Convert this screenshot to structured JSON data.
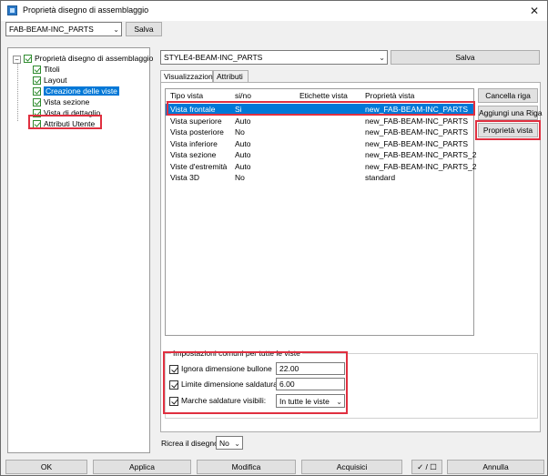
{
  "window": {
    "title": "Proprietà disegno di assemblaggio",
    "close_glyph": "✕"
  },
  "topbar": {
    "preset_value": "FAB-BEAM-INC_PARTS",
    "save_label": "Salva"
  },
  "tree": {
    "root_label": "Proprietà disegno di assemblaggio",
    "items": [
      {
        "label": "Titoli"
      },
      {
        "label": "Layout"
      },
      {
        "label": "Creazione delle viste",
        "selected": true
      },
      {
        "label": "Vista sezione"
      },
      {
        "label": "Vista di dettaglio"
      },
      {
        "label": "Attributi Utente",
        "highlighted": true
      }
    ]
  },
  "right": {
    "style_value": "STYLE4-BEAM-INC_PARTS",
    "save_label": "Salva",
    "tabs": [
      {
        "label": "Visualizzazioni",
        "active": true
      },
      {
        "label": "Attributi",
        "active": false
      }
    ]
  },
  "grid": {
    "columns": [
      "Tipo vista",
      "si/no",
      "Etichette vista",
      "Proprietà vista"
    ],
    "rows": [
      {
        "tipo": "Vista frontale",
        "sino": "Si",
        "etichette": "",
        "proprieta": "new_FAB-BEAM-INC_PARTS",
        "selected": true
      },
      {
        "tipo": "Vista superiore",
        "sino": "Auto",
        "etichette": "",
        "proprieta": "new_FAB-BEAM-INC_PARTS"
      },
      {
        "tipo": "Vista posteriore",
        "sino": "No",
        "etichette": "",
        "proprieta": "new_FAB-BEAM-INC_PARTS"
      },
      {
        "tipo": "Vista inferiore",
        "sino": "Auto",
        "etichette": "",
        "proprieta": "new_FAB-BEAM-INC_PARTS"
      },
      {
        "tipo": "Vista sezione",
        "sino": "Auto",
        "etichette": "",
        "proprieta": "new_FAB-BEAM-INC_PARTS_2"
      },
      {
        "tipo": "Viste d'estremità",
        "sino": "Auto",
        "etichette": "",
        "proprieta": "new_FAB-BEAM-INC_PARTS_2"
      },
      {
        "tipo": "Vista 3D",
        "sino": "No",
        "etichette": "",
        "proprieta": "standard"
      }
    ]
  },
  "side_buttons": {
    "delete_row": "Cancella riga",
    "add_row": "Aggiungi una Riga",
    "view_props": "Proprietà vista"
  },
  "common": {
    "legend": "Impostazioni comuni per tutte le viste",
    "options": [
      {
        "label": "Ignora dimensione bullone",
        "value": "22.00",
        "checked": true
      },
      {
        "label": "Limite dimensione saldatura",
        "value": "6.00",
        "checked": true
      }
    ],
    "welds": {
      "label": "Marche saldature visibili:",
      "value": "In tutte le viste",
      "checked": true
    }
  },
  "redraw": {
    "label": "Ricrea il disegno",
    "value": "No"
  },
  "footer": {
    "ok": "OK",
    "apply": "Applica",
    "modify": "Modifica",
    "acquire": "Acquisici",
    "toggle": "✓ / ☐",
    "cancel": "Annulla"
  },
  "colors": {
    "accent": "#0078d7",
    "highlight_box": "#e03040",
    "tree_check": "#2e8b2e"
  }
}
